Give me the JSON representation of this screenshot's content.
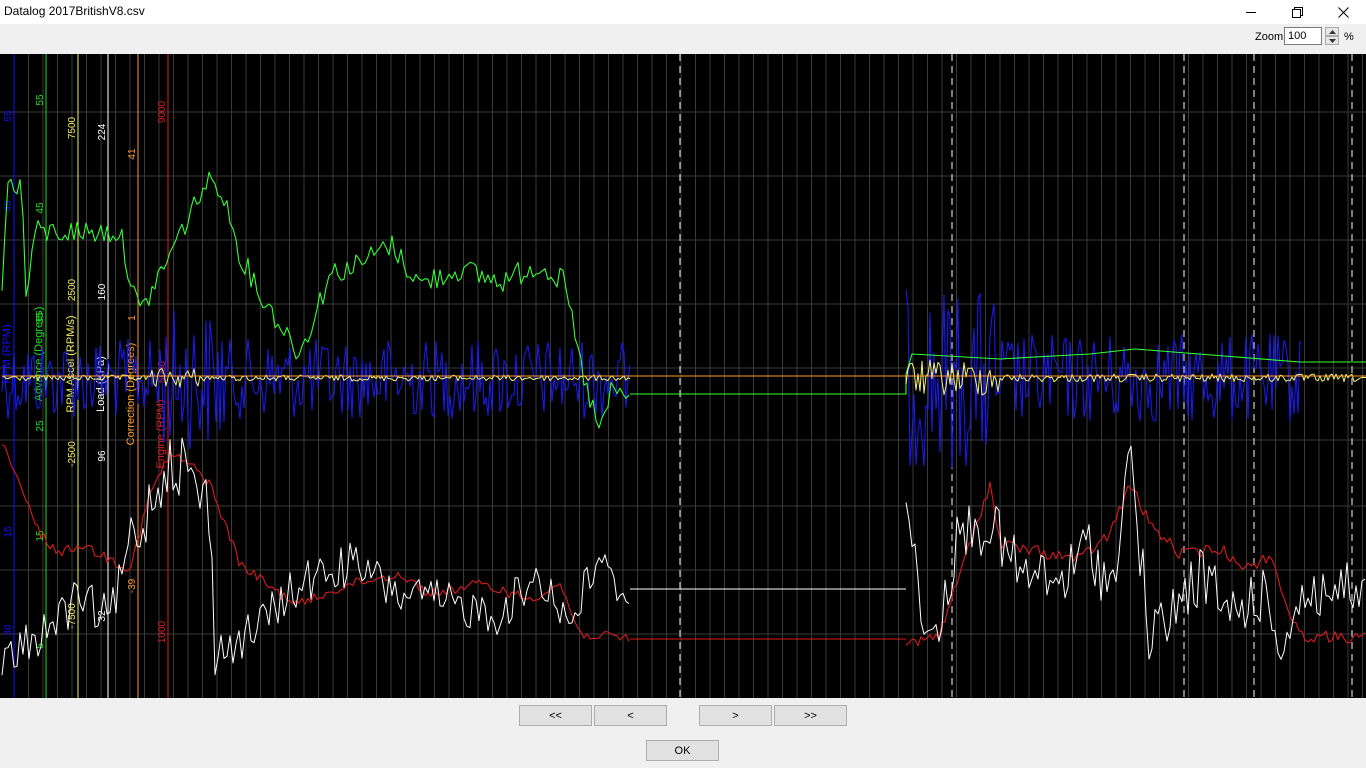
{
  "window": {
    "title": "Datalog 2017BritishV8.csv",
    "controls": {
      "minimize": "—",
      "restore": "❐",
      "close": "✕"
    }
  },
  "toolbar": {
    "zoom_label": "Zoom",
    "zoom_value": "100",
    "zoom_unit": "%"
  },
  "navigation": {
    "first": "<<",
    "prev": "<",
    "next": ">",
    "last": ">>",
    "ok": "OK"
  },
  "chart_data": {
    "type": "line",
    "background": "#000000",
    "grid": true,
    "axes": [
      {
        "label": "RPM (RPM)",
        "color": "#1010ff",
        "ticks": [
          "55",
          "45",
          "15",
          "30"
        ]
      },
      {
        "label": "Advance (Degrees)",
        "color": "#20e020",
        "ticks": [
          "55",
          "45",
          "35",
          "25",
          "15",
          "5"
        ]
      },
      {
        "label": "RPM Accel (RPM/s)",
        "color": "#f0f060",
        "ticks": [
          "7500",
          "2500",
          "-2500",
          "-7500"
        ]
      },
      {
        "label": "Load (KPa)",
        "color": "#ffffff",
        "ticks": [
          "224",
          "160",
          "96",
          "32"
        ]
      },
      {
        "label": "Correction (Degrees)",
        "color": "#ff9a2e",
        "ticks": [
          "41",
          "1",
          "-39"
        ]
      },
      {
        "label": "Engine (RPM)",
        "color": "#e02020",
        "ticks": [
          "9000",
          "5000",
          "1000"
        ]
      }
    ],
    "series": [
      {
        "name": "RPM",
        "color": "#1a1aff"
      },
      {
        "name": "Advance",
        "color": "#33ff33"
      },
      {
        "name": "RPM Accel",
        "color": "#f5f57a"
      },
      {
        "name": "Load",
        "color": "#ffffff"
      },
      {
        "name": "Correction",
        "color": "#ff9a2e"
      },
      {
        "name": "Engine",
        "color": "#dd1a1a"
      }
    ]
  }
}
